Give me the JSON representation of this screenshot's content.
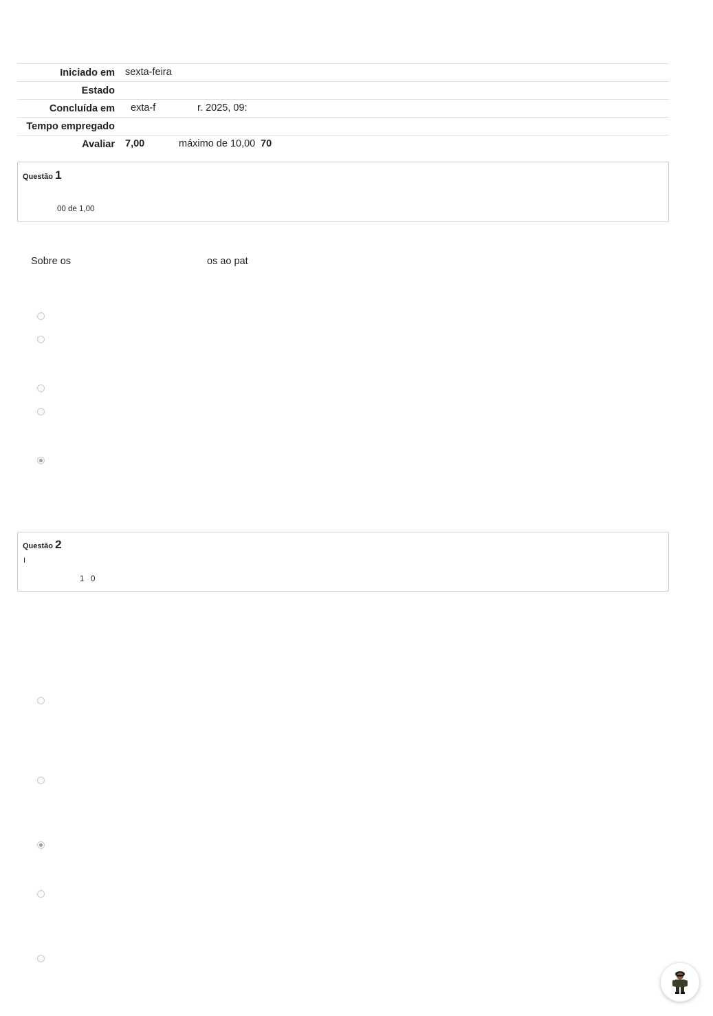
{
  "summary": {
    "rows": [
      {
        "label": "Iniciado em",
        "parts": [
          "sexta-feira"
        ]
      },
      {
        "label": "Estado",
        "parts": []
      },
      {
        "label": "Concluída em",
        "parts": [
          "exta-f",
          "r. 2025, 09:"
        ]
      },
      {
        "label": "Tempo empregado",
        "parts": []
      },
      {
        "label": "Avaliar",
        "parts": [
          "7,00",
          "máximo de 10,00",
          "70"
        ]
      }
    ]
  },
  "questions": [
    {
      "prefix": "Questão",
      "number": "1",
      "flag": "",
      "grade": "00 de 1,00",
      "text_parts": [
        "Sobre os",
        "os ao pat"
      ],
      "options_selected": [
        false,
        false,
        false,
        false,
        true
      ]
    },
    {
      "prefix": "Questão",
      "number": "2",
      "flag": "I",
      "grade_parts": [
        "1",
        "0"
      ],
      "text_parts": [],
      "options_selected": [
        false,
        false,
        true,
        false,
        false
      ]
    }
  ],
  "helper": {
    "icon": "assistant-avatar-icon"
  }
}
